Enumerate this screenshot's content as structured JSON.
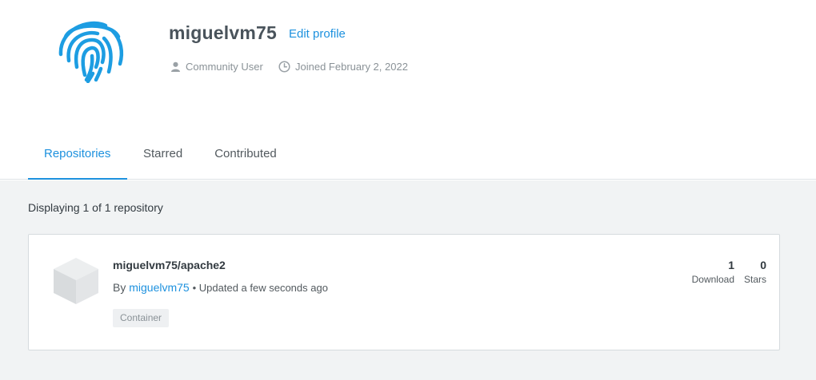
{
  "profile": {
    "username": "miguelvm75",
    "edit_label": "Edit profile",
    "role": "Community User",
    "joined": "Joined February 2, 2022",
    "avatar_icon": "fingerprint-icon",
    "accent_color": "#1d91de"
  },
  "tabs": [
    {
      "label": "Repositories",
      "active": true
    },
    {
      "label": "Starred",
      "active": false
    },
    {
      "label": "Contributed",
      "active": false
    }
  ],
  "repositories": {
    "count_text": "Displaying 1 of 1 repository",
    "items": [
      {
        "name": "miguelvm75/apache2",
        "by_label": "By",
        "owner": "miguelvm75",
        "updated": "• Updated a few seconds ago",
        "badge": "Container",
        "downloads_value": "1",
        "downloads_label": "Download",
        "stars_value": "0",
        "stars_label": "Stars",
        "icon": "cube-icon"
      }
    ]
  }
}
